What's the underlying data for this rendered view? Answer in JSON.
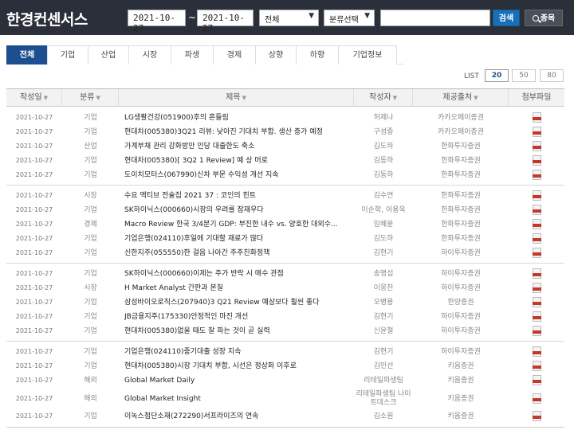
{
  "header": {
    "brand": "한경컨센서스",
    "start_date": "2021-10-27",
    "end_date": "2021-10-27",
    "tilde": "~",
    "select_all": "전체",
    "select_category": "분류선택",
    "search_button": "검색",
    "stock_button": "종목",
    "search_placeholder": ""
  },
  "tabs": [
    "전체",
    "기업",
    "산업",
    "시장",
    "파생",
    "경제",
    "상향",
    "하향",
    "기업정보"
  ],
  "list": {
    "label": "LIST",
    "options": [
      "20",
      "50",
      "80"
    ],
    "selected": "20"
  },
  "columns": [
    "작성일",
    "분류",
    "제목",
    "작성자",
    "제공출처",
    "첨부파일"
  ],
  "rows": [
    {
      "date": "2021-10-27",
      "cat": "기업",
      "title": "LG생활건강(051900)후의 흔들림",
      "author": "허제나",
      "source": "카카오페이증권"
    },
    {
      "date": "2021-10-27",
      "cat": "기업",
      "title": "현대차(005380)3Q21 리뷰: 낮아진 기대치 부합. 생산 증가 예정",
      "author": "구성중",
      "source": "카카오페이증권"
    },
    {
      "date": "2021-10-27",
      "cat": "산업",
      "title": "가계부채 관리 강화방안 인당 대출한도 축소",
      "author": "김도하",
      "source": "한화투자증권"
    },
    {
      "date": "2021-10-27",
      "cat": "기업",
      "title": "현대차(005380)[ 3Q2 1 Review] 예 상 머로",
      "author": "김동하",
      "source": "한화투자증권"
    },
    {
      "date": "2021-10-27",
      "cat": "기업",
      "title": "도이치모터스(067990)신차 부문 수익성 개선 지속",
      "author": "김동하",
      "source": "한화투자증권"
    },
    {
      "date": "2021-10-27",
      "cat": "시장",
      "title": "수요 액티브 전술집 2021 37 : 코인의 힌트",
      "author": "김수연",
      "source": "한화투자증권"
    },
    {
      "date": "2021-10-27",
      "cat": "기업",
      "title": "SK하이닉스(000660)시장의 우려를 잠재우다",
      "author": "이순학, 이용욱",
      "source": "한화투자증권"
    },
    {
      "date": "2021-10-27",
      "cat": "경제",
      "title": "Macro Review 한국 3/4분기 GDP: 부진한 내수 vs. 양호한 대외수...",
      "author": "임혜윤",
      "source": "한화투자증권"
    },
    {
      "date": "2021-10-27",
      "cat": "기업",
      "title": "기업은행(024110)후일에 기대할 재료가 많다",
      "author": "김도하",
      "source": "한화투자증권"
    },
    {
      "date": "2021-10-27",
      "cat": "기업",
      "title": "신한지주(055550)한 걸음 나아간 주주친화정책",
      "author": "김현기",
      "source": "하이투자증권"
    },
    {
      "date": "2021-10-27",
      "cat": "기업",
      "title": "SK하이닉스(000660)이제는 주가 반락 시 매수 관점",
      "author": "송명섭",
      "source": "하이투자증권"
    },
    {
      "date": "2021-10-27",
      "cat": "시장",
      "title": "H Market Analyst 간판과 본질",
      "author": "이웅찬",
      "source": "하이투자증권"
    },
    {
      "date": "2021-10-27",
      "cat": "기업",
      "title": "삼성바이오로직스(207940)3 Q21 Review 예상보다 훨씬 좋다",
      "author": "오병용",
      "source": "한양증권"
    },
    {
      "date": "2021-10-27",
      "cat": "기업",
      "title": "JB금융지주(175330)안정적인 마진 개선",
      "author": "김현기",
      "source": "하이투자증권"
    },
    {
      "date": "2021-10-27",
      "cat": "기업",
      "title": "현대차(005380)없을 때도 잘 파는 것이 곧 실력",
      "author": "신윤철",
      "source": "하이투자증권"
    },
    {
      "date": "2021-10-27",
      "cat": "기업",
      "title": "기업은행(024110)중기대출 성장 지속",
      "author": "김현기",
      "source": "하이투자증권"
    },
    {
      "date": "2021-10-27",
      "cat": "기업",
      "title": "현대차(005380)시장 기대치 부합, 시선은 정상화 이후로",
      "author": "김민선",
      "source": "키움증권"
    },
    {
      "date": "2021-10-27",
      "cat": "해외",
      "title": "Global Market Daily",
      "author": "리테일파생팀",
      "source": "키움증권"
    },
    {
      "date": "2021-10-27",
      "cat": "해외",
      "title": "Global Market Insight",
      "author": "리테일파생팀 나이트데스크",
      "source": "키움증권"
    },
    {
      "date": "2021-10-27",
      "cat": "기업",
      "title": "이녹스첨단소재(272290)서프라이즈의 연속",
      "author": "김소원",
      "source": "키움증권"
    }
  ]
}
